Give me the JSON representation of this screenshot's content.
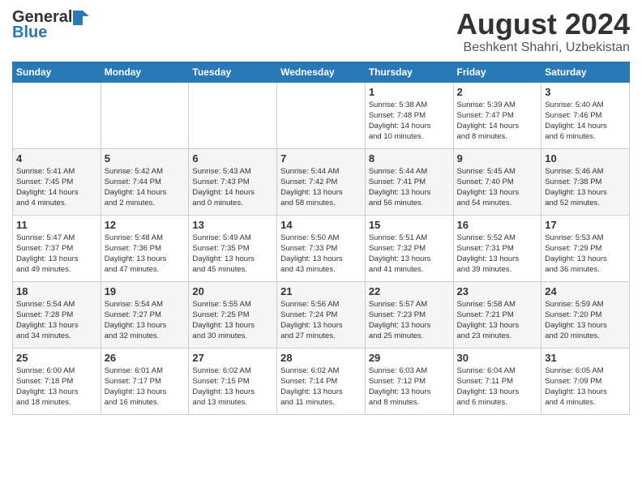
{
  "header": {
    "logo_general": "General",
    "logo_blue": "Blue",
    "title": "August 2024",
    "subtitle": "Beshkent Shahri, Uzbekistan"
  },
  "days_of_week": [
    "Sunday",
    "Monday",
    "Tuesday",
    "Wednesday",
    "Thursday",
    "Friday",
    "Saturday"
  ],
  "weeks": [
    [
      {
        "num": "",
        "info": ""
      },
      {
        "num": "",
        "info": ""
      },
      {
        "num": "",
        "info": ""
      },
      {
        "num": "",
        "info": ""
      },
      {
        "num": "1",
        "info": "Sunrise: 5:38 AM\nSunset: 7:48 PM\nDaylight: 14 hours\nand 10 minutes."
      },
      {
        "num": "2",
        "info": "Sunrise: 5:39 AM\nSunset: 7:47 PM\nDaylight: 14 hours\nand 8 minutes."
      },
      {
        "num": "3",
        "info": "Sunrise: 5:40 AM\nSunset: 7:46 PM\nDaylight: 14 hours\nand 6 minutes."
      }
    ],
    [
      {
        "num": "4",
        "info": "Sunrise: 5:41 AM\nSunset: 7:45 PM\nDaylight: 14 hours\nand 4 minutes."
      },
      {
        "num": "5",
        "info": "Sunrise: 5:42 AM\nSunset: 7:44 PM\nDaylight: 14 hours\nand 2 minutes."
      },
      {
        "num": "6",
        "info": "Sunrise: 5:43 AM\nSunset: 7:43 PM\nDaylight: 14 hours\nand 0 minutes."
      },
      {
        "num": "7",
        "info": "Sunrise: 5:44 AM\nSunset: 7:42 PM\nDaylight: 13 hours\nand 58 minutes."
      },
      {
        "num": "8",
        "info": "Sunrise: 5:44 AM\nSunset: 7:41 PM\nDaylight: 13 hours\nand 56 minutes."
      },
      {
        "num": "9",
        "info": "Sunrise: 5:45 AM\nSunset: 7:40 PM\nDaylight: 13 hours\nand 54 minutes."
      },
      {
        "num": "10",
        "info": "Sunrise: 5:46 AM\nSunset: 7:38 PM\nDaylight: 13 hours\nand 52 minutes."
      }
    ],
    [
      {
        "num": "11",
        "info": "Sunrise: 5:47 AM\nSunset: 7:37 PM\nDaylight: 13 hours\nand 49 minutes."
      },
      {
        "num": "12",
        "info": "Sunrise: 5:48 AM\nSunset: 7:36 PM\nDaylight: 13 hours\nand 47 minutes."
      },
      {
        "num": "13",
        "info": "Sunrise: 5:49 AM\nSunset: 7:35 PM\nDaylight: 13 hours\nand 45 minutes."
      },
      {
        "num": "14",
        "info": "Sunrise: 5:50 AM\nSunset: 7:33 PM\nDaylight: 13 hours\nand 43 minutes."
      },
      {
        "num": "15",
        "info": "Sunrise: 5:51 AM\nSunset: 7:32 PM\nDaylight: 13 hours\nand 41 minutes."
      },
      {
        "num": "16",
        "info": "Sunrise: 5:52 AM\nSunset: 7:31 PM\nDaylight: 13 hours\nand 39 minutes."
      },
      {
        "num": "17",
        "info": "Sunrise: 5:53 AM\nSunset: 7:29 PM\nDaylight: 13 hours\nand 36 minutes."
      }
    ],
    [
      {
        "num": "18",
        "info": "Sunrise: 5:54 AM\nSunset: 7:28 PM\nDaylight: 13 hours\nand 34 minutes."
      },
      {
        "num": "19",
        "info": "Sunrise: 5:54 AM\nSunset: 7:27 PM\nDaylight: 13 hours\nand 32 minutes."
      },
      {
        "num": "20",
        "info": "Sunrise: 5:55 AM\nSunset: 7:25 PM\nDaylight: 13 hours\nand 30 minutes."
      },
      {
        "num": "21",
        "info": "Sunrise: 5:56 AM\nSunset: 7:24 PM\nDaylight: 13 hours\nand 27 minutes."
      },
      {
        "num": "22",
        "info": "Sunrise: 5:57 AM\nSunset: 7:23 PM\nDaylight: 13 hours\nand 25 minutes."
      },
      {
        "num": "23",
        "info": "Sunrise: 5:58 AM\nSunset: 7:21 PM\nDaylight: 13 hours\nand 23 minutes."
      },
      {
        "num": "24",
        "info": "Sunrise: 5:59 AM\nSunset: 7:20 PM\nDaylight: 13 hours\nand 20 minutes."
      }
    ],
    [
      {
        "num": "25",
        "info": "Sunrise: 6:00 AM\nSunset: 7:18 PM\nDaylight: 13 hours\nand 18 minutes."
      },
      {
        "num": "26",
        "info": "Sunrise: 6:01 AM\nSunset: 7:17 PM\nDaylight: 13 hours\nand 16 minutes."
      },
      {
        "num": "27",
        "info": "Sunrise: 6:02 AM\nSunset: 7:15 PM\nDaylight: 13 hours\nand 13 minutes."
      },
      {
        "num": "28",
        "info": "Sunrise: 6:02 AM\nSunset: 7:14 PM\nDaylight: 13 hours\nand 11 minutes."
      },
      {
        "num": "29",
        "info": "Sunrise: 6:03 AM\nSunset: 7:12 PM\nDaylight: 13 hours\nand 8 minutes."
      },
      {
        "num": "30",
        "info": "Sunrise: 6:04 AM\nSunset: 7:11 PM\nDaylight: 13 hours\nand 6 minutes."
      },
      {
        "num": "31",
        "info": "Sunrise: 6:05 AM\nSunset: 7:09 PM\nDaylight: 13 hours\nand 4 minutes."
      }
    ]
  ]
}
